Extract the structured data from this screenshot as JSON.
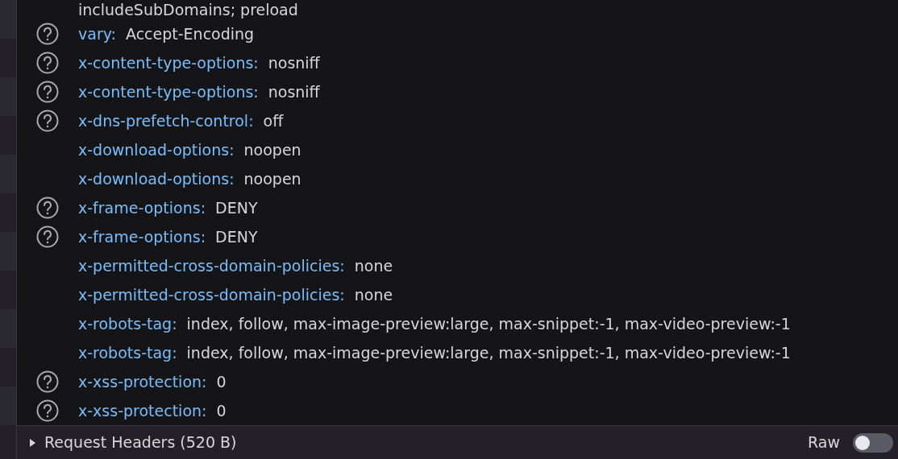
{
  "continued_value": "includeSubDomains; preload",
  "headers": [
    {
      "name": "vary:",
      "value": "Accept-Encoding",
      "has_help": true
    },
    {
      "name": "x-content-type-options:",
      "value": "nosniff",
      "has_help": true
    },
    {
      "name": "x-content-type-options:",
      "value": "nosniff",
      "has_help": true
    },
    {
      "name": "x-dns-prefetch-control:",
      "value": "off",
      "has_help": true
    },
    {
      "name": "x-download-options:",
      "value": "noopen",
      "has_help": false
    },
    {
      "name": "x-download-options:",
      "value": "noopen",
      "has_help": false
    },
    {
      "name": "x-frame-options:",
      "value": "DENY",
      "has_help": true
    },
    {
      "name": "x-frame-options:",
      "value": "DENY",
      "has_help": true
    },
    {
      "name": "x-permitted-cross-domain-policies:",
      "value": "none",
      "has_help": false
    },
    {
      "name": "x-permitted-cross-domain-policies:",
      "value": "none",
      "has_help": false
    },
    {
      "name": "x-robots-tag:",
      "value": "index, follow, max-image-preview:large, max-snippet:-1, max-video-preview:-1",
      "has_help": false
    },
    {
      "name": "x-robots-tag:",
      "value": "index, follow, max-image-preview:large, max-snippet:-1, max-video-preview:-1",
      "has_help": false
    },
    {
      "name": "x-xss-protection:",
      "value": "0",
      "has_help": true
    },
    {
      "name": "x-xss-protection:",
      "value": "0",
      "has_help": true
    }
  ],
  "section": {
    "title": "Request Headers (520 B)",
    "expanded": false,
    "raw": {
      "label": "Raw",
      "on": false
    }
  }
}
